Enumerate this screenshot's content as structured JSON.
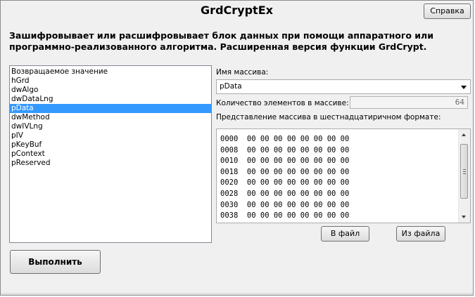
{
  "window": {
    "title": "GrdCryptEx",
    "help_button": "Справка",
    "description_line1": "Зашифровывает или расшифровывает блок данных при помощи аппаратного или",
    "description_line2": "программно-реализованного алгоритма. Расширенная версия функции GrdCrypt."
  },
  "params": {
    "items": [
      "Возвращаемое значение",
      "hGrd",
      "dwAlgo",
      "dwDataLng",
      "pData",
      "dwMethod",
      "dwIVLng",
      "pIV",
      "pKeyBuf",
      "pContext",
      "pReserved"
    ],
    "selected": "pData"
  },
  "array": {
    "name_label": "Имя массива:",
    "selected_name": "pData",
    "count_label": "Количество элементов в массиве:",
    "count_value": "64",
    "hex_label": "Представление массива в шестнадцатиричном формате:",
    "hex_rows": [
      "0000  00 00 00 00 00 00 00 00",
      "0008  00 00 00 00 00 00 00 00",
      "0010  00 00 00 00 00 00 00 00",
      "0018  00 00 00 00 00 00 00 00",
      "0020  00 00 00 00 00 00 00 00",
      "0028  00 00 00 00 00 00 00 00",
      "0030  00 00 00 00 00 00 00 00",
      "0038  00 00 00 00 00 00 00 00"
    ],
    "to_file_button": "В файл",
    "from_file_button": "Из файла"
  },
  "actions": {
    "run_button": "Выполнить"
  },
  "colors": {
    "selection": "#3399ff",
    "window_bg": "#f0f0f0"
  }
}
